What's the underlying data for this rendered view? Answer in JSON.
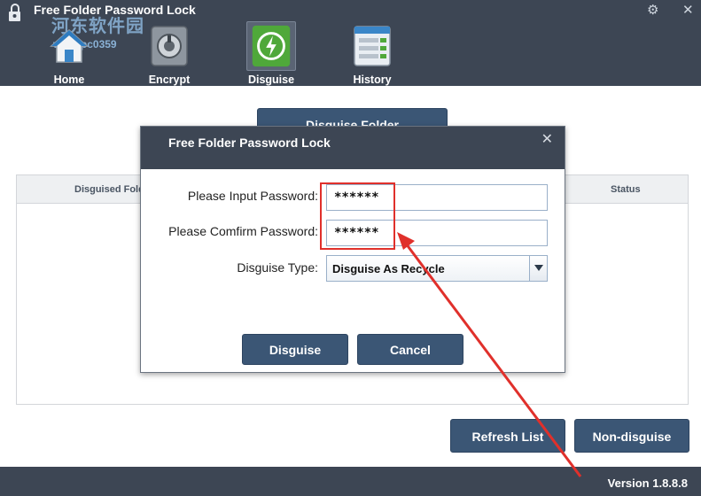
{
  "window": {
    "title": "Free Folder Password Lock",
    "settings_glyph": "⚙",
    "close_glyph": "✕"
  },
  "watermark": {
    "text_cn": "河东软件园",
    "url": "www.pc0359"
  },
  "nav": {
    "items": [
      {
        "label": "Home",
        "icon": "home-icon"
      },
      {
        "label": "Encrypt",
        "icon": "safe-lock-icon"
      },
      {
        "label": "Disguise",
        "icon": "disguise-shield-icon",
        "active": true
      },
      {
        "label": "History",
        "icon": "history-list-icon"
      }
    ]
  },
  "main": {
    "top_button_label": "Disguise Folder",
    "table": {
      "columns": [
        "Disguised Folder",
        "Status"
      ]
    },
    "refresh_label": "Refresh List",
    "non_disguise_label": "Non-disguise"
  },
  "footer": {
    "version": "Version 1.8.8.8"
  },
  "dialog": {
    "title": "Free Folder Password Lock",
    "close_glyph": "✕",
    "password_label": "Please Input Password:",
    "password_value": "******",
    "confirm_label": "Please Comfirm Password:",
    "confirm_value": "******",
    "type_label": "Disguise Type:",
    "type_value": "Disguise As Recycle",
    "ok_label": "Disguise",
    "cancel_label": "Cancel"
  },
  "colors": {
    "header_bg": "#3d4654",
    "button_bg": "#3b5675",
    "annotation_red": "#e0302b"
  }
}
